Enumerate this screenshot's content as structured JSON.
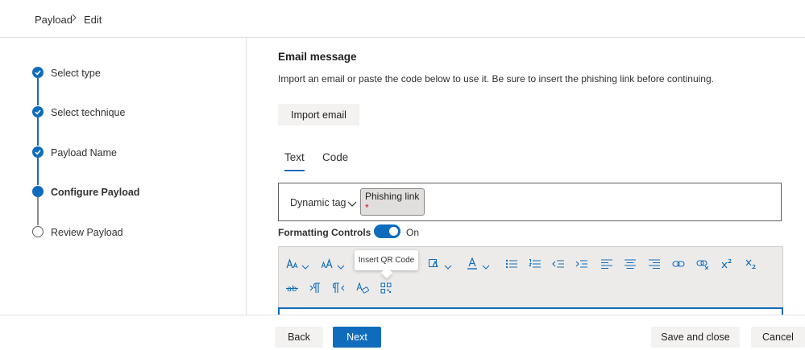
{
  "breadcrumb": {
    "root": "Payload",
    "current": "Edit"
  },
  "steps": [
    {
      "label": "Select type",
      "state": "done"
    },
    {
      "label": "Select technique",
      "state": "done"
    },
    {
      "label": "Payload Name",
      "state": "done"
    },
    {
      "label": "Configure Payload",
      "state": "current"
    },
    {
      "label": "Review Payload",
      "state": "todo"
    }
  ],
  "email": {
    "title": "Email message",
    "description": "Import an email or paste the code below to use it. Be sure to insert the phishing link before continuing.",
    "import_label": "Import email"
  },
  "tabs": {
    "text": "Text",
    "code": "Code",
    "selected": "Text"
  },
  "dynamic_tag": {
    "label": "Dynamic tag",
    "chip_label": "Phishing link",
    "required_mark": "*"
  },
  "formatting": {
    "label": "Formatting Controls",
    "state": "On",
    "enabled": true
  },
  "toolbar": {
    "tooltip": "Insert QR Code",
    "icons": [
      "font-family-icon",
      "font-size-icon",
      "highlight-icon",
      "font-color-icon",
      "bulleted-list-icon",
      "numbered-list-icon",
      "decrease-indent-icon",
      "increase-indent-icon",
      "align-left-icon",
      "align-center-icon",
      "align-right-icon",
      "link-icon",
      "unlink-icon",
      "superscript-icon",
      "subscript-icon",
      "strikethrough-icon",
      "ltr-icon",
      "rtl-icon",
      "clear-format-icon",
      "qr-code-icon"
    ]
  },
  "footer": {
    "back": "Back",
    "next": "Next",
    "save_close": "Save and close",
    "cancel": "Cancel"
  },
  "colors": {
    "accent": "#0f6cbd",
    "required": "#c50f1f",
    "border": "#e1dfdd"
  }
}
